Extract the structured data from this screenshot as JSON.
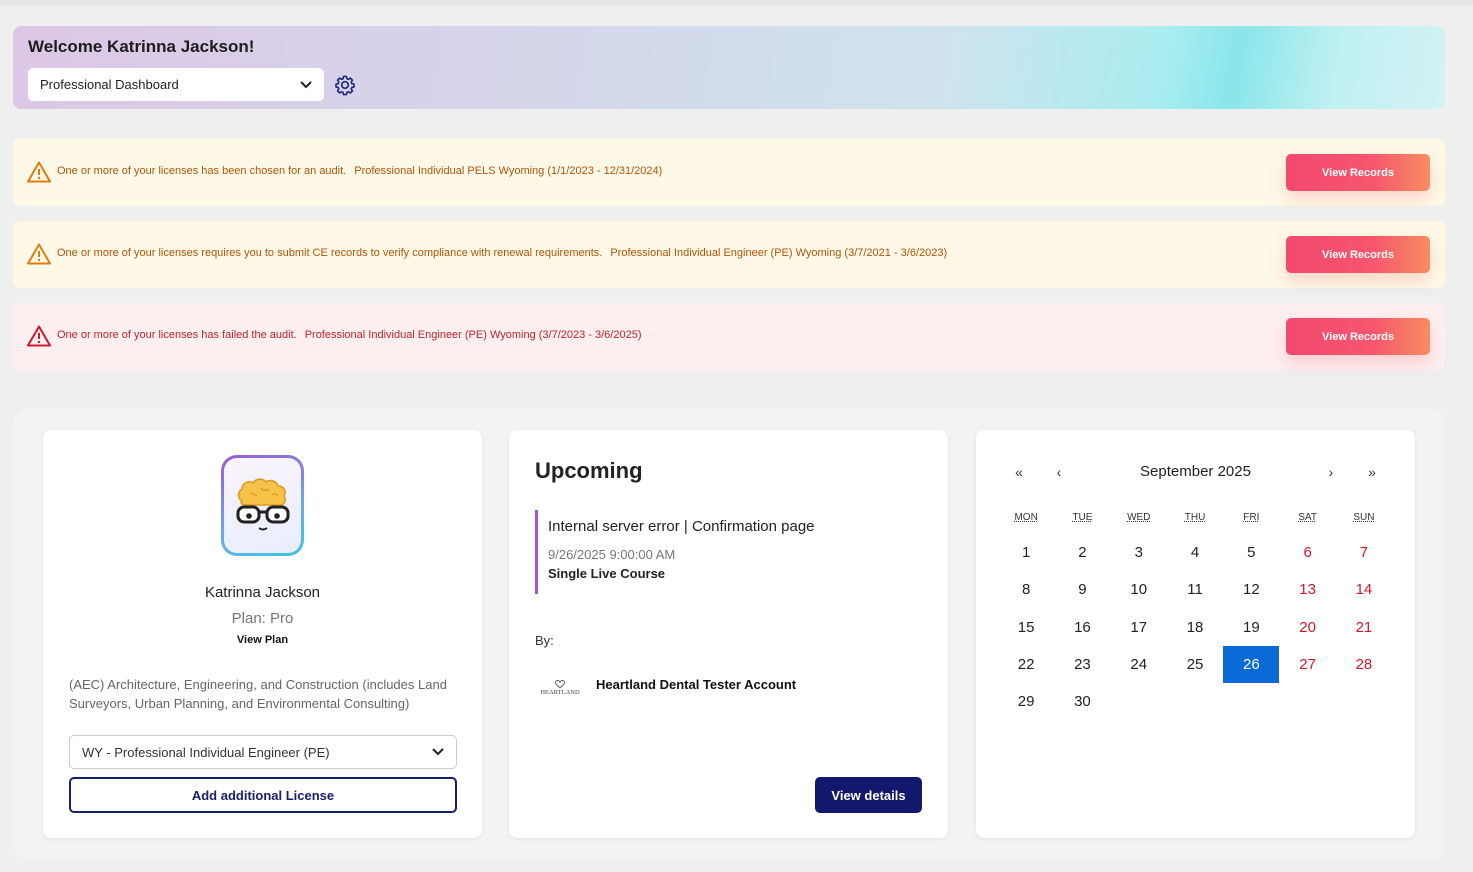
{
  "header": {
    "welcome": "Welcome Katrinna Jackson!",
    "dashboard_select": "Professional Dashboard"
  },
  "alerts": [
    {
      "severity": "warning",
      "message": "One or more of your licenses has been chosen for an audit.",
      "license": "Professional Individual PELS Wyoming (1/1/2023 - 12/31/2024)",
      "button": "View Records"
    },
    {
      "severity": "warning",
      "message": "One or more of your licenses requires you to submit CE records to verify compliance with renewal requirements.",
      "license": "Professional Individual Engineer (PE) Wyoming (3/7/2021 - 3/6/2023)",
      "button": "View Records"
    },
    {
      "severity": "error",
      "message": "One or more of your licenses has failed the audit.",
      "license": "Professional Individual Engineer (PE) Wyoming (3/7/2023 - 3/6/2025)",
      "button": "View Records"
    }
  ],
  "profile": {
    "name": "Katrinna Jackson",
    "plan": "Plan: Pro",
    "view_plan": "View Plan",
    "industry": "(AEC) Architecture, Engineering, and Construction (includes Land Surveyors, Urban Planning, and Environmental Consulting)",
    "license_select": "WY - Professional Individual Engineer (PE)",
    "add_license": "Add additional License"
  },
  "upcoming": {
    "title": "Upcoming",
    "event_title": "Internal server error | Confirmation page",
    "event_datetime": "9/26/2025 9:00:00 AM",
    "event_type": "Single Live Course",
    "by_label": "By:",
    "org_logo_text": "HEARTLAND",
    "org_name": "Heartland Dental Tester Account",
    "details_button": "View details"
  },
  "calendar": {
    "nav_first": "«",
    "nav_prev": "‹",
    "nav_next": "›",
    "nav_last": "»",
    "month_label": "September 2025",
    "weekdays": [
      "MON",
      "TUE",
      "WED",
      "THU",
      "FRI",
      "SAT",
      "SUN"
    ],
    "days": [
      "1",
      "2",
      "3",
      "4",
      "5",
      "6",
      "7",
      "8",
      "9",
      "10",
      "11",
      "12",
      "13",
      "14",
      "15",
      "16",
      "17",
      "18",
      "19",
      "20",
      "21",
      "22",
      "23",
      "24",
      "25",
      "26",
      "27",
      "28",
      "29",
      "30"
    ],
    "selected_day": "26",
    "colors": {
      "weekend": "#d1182a",
      "selected": "#0a6ad8"
    }
  },
  "colors": {
    "alert_warning_bg": "#fdf9e6",
    "alert_error_bg": "#fdeff0",
    "button_gradient_start": "#f3496f",
    "navy": "#12186b"
  }
}
